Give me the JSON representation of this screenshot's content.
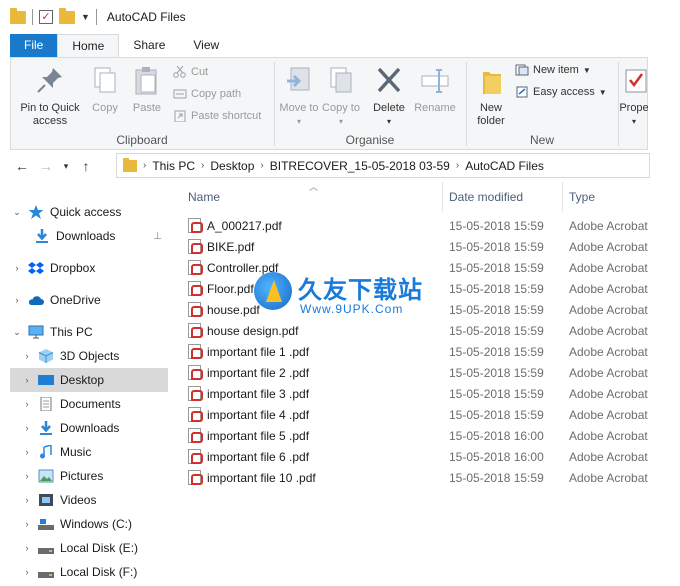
{
  "window": {
    "title": "AutoCAD Files"
  },
  "ribbon": {
    "tabs": [
      {
        "label": "File"
      },
      {
        "label": "Home"
      },
      {
        "label": "Share"
      },
      {
        "label": "View"
      }
    ],
    "clipboard": {
      "label": "Clipboard",
      "pin": "Pin to Quick access",
      "copy": "Copy",
      "paste": "Paste",
      "cut": "Cut",
      "copy_path": "Copy path",
      "paste_shortcut": "Paste shortcut"
    },
    "organise": {
      "label": "Organise",
      "move_to": "Move to",
      "copy_to": "Copy to",
      "delete": "Delete",
      "rename": "Rename"
    },
    "new": {
      "label": "New",
      "new_folder": "New folder",
      "new_item": "New item",
      "easy_access": "Easy access"
    },
    "open": {
      "properties": "Prope"
    }
  },
  "address": {
    "crumbs": [
      "This PC",
      "Desktop",
      "BITRECOVER_15-05-2018 03-59",
      "AutoCAD Files"
    ]
  },
  "nav": {
    "items": [
      {
        "label": "Quick access",
        "icon": "star-icon"
      },
      {
        "label": "Downloads",
        "icon": "download-icon"
      },
      {
        "label": "Dropbox",
        "icon": "dropbox-icon"
      },
      {
        "label": "OneDrive",
        "icon": "cloud-icon"
      },
      {
        "label": "This PC",
        "icon": "computer-icon"
      },
      {
        "label": "3D Objects",
        "icon": "cube-icon"
      },
      {
        "label": "Desktop",
        "icon": "desktop-icon"
      },
      {
        "label": "Documents",
        "icon": "document-icon"
      },
      {
        "label": "Downloads",
        "icon": "download-icon"
      },
      {
        "label": "Music",
        "icon": "music-icon"
      },
      {
        "label": "Pictures",
        "icon": "pictures-icon"
      },
      {
        "label": "Videos",
        "icon": "video-icon"
      },
      {
        "label": "Windows (C:)",
        "icon": "drive-icon"
      },
      {
        "label": "Local Disk (E:)",
        "icon": "drive-icon"
      },
      {
        "label": "Local Disk (F:)",
        "icon": "drive-icon"
      }
    ]
  },
  "files": {
    "columns": {
      "name": "Name",
      "date": "Date modified",
      "type": "Type"
    },
    "rows": [
      {
        "name": "A_000217.pdf",
        "date": "15-05-2018 15:59",
        "type": "Adobe Acrobat"
      },
      {
        "name": "BIKE.pdf",
        "date": "15-05-2018 15:59",
        "type": "Adobe Acrobat"
      },
      {
        "name": "Controller.pdf",
        "date": "15-05-2018 15:59",
        "type": "Adobe Acrobat"
      },
      {
        "name": "Floor.pdf",
        "date": "15-05-2018 15:59",
        "type": "Adobe Acrobat"
      },
      {
        "name": "house.pdf",
        "date": "15-05-2018 15:59",
        "type": "Adobe Acrobat"
      },
      {
        "name": "house design.pdf",
        "date": "15-05-2018 15:59",
        "type": "Adobe Acrobat"
      },
      {
        "name": "important file 1 .pdf",
        "date": "15-05-2018 15:59",
        "type": "Adobe Acrobat"
      },
      {
        "name": "important file 2 .pdf",
        "date": "15-05-2018 15:59",
        "type": "Adobe Acrobat"
      },
      {
        "name": "important file 3 .pdf",
        "date": "15-05-2018 15:59",
        "type": "Adobe Acrobat"
      },
      {
        "name": "important file 4 .pdf",
        "date": "15-05-2018 15:59",
        "type": "Adobe Acrobat"
      },
      {
        "name": "important file 5 .pdf",
        "date": "15-05-2018 16:00",
        "type": "Adobe Acrobat"
      },
      {
        "name": "important file 6 .pdf",
        "date": "15-05-2018 16:00",
        "type": "Adobe Acrobat"
      },
      {
        "name": "important file 10 .pdf",
        "date": "15-05-2018 15:59",
        "type": "Adobe Acrobat"
      }
    ]
  },
  "watermark": {
    "title": "久友下载站",
    "url": "Www.9UPK.Com"
  },
  "colors": {
    "file_tab": "#1979ca",
    "folder": "#e8b93a",
    "pdf_red": "#d0312d",
    "selected": "#d9d9d9"
  }
}
